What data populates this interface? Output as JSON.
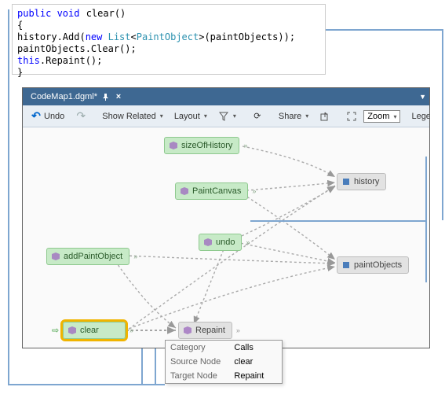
{
  "code": {
    "line1_pre": "public void ",
    "line1_method": "clear",
    "line1_post": "()",
    "line2": "{",
    "line3a": "    history.Add(",
    "line3b": "new ",
    "line3c": "List",
    "line3d": "<",
    "line3e": "PaintObject",
    "line3f": ">(paintObjects));",
    "line4": "    paintObjects.Clear();",
    "line5a": "    ",
    "line5b": "this",
    "line5c": ".Repaint();",
    "line6": "}"
  },
  "tab": {
    "title": "CodeMap1.dgml*"
  },
  "toolbar": {
    "undo": "Undo",
    "show_related": "Show Related",
    "layout": "Layout",
    "share": "Share",
    "zoom": "Zoom",
    "legend": "Legend"
  },
  "nodes": {
    "sizeOfHistory": "sizeOfHistory",
    "paintCanvas": "PaintCanvas",
    "addPaintObject": "addPaintObject",
    "undo": "undo",
    "clear": "clear",
    "history": "history",
    "paintObjects": "paintObjects",
    "repaint": "Repaint"
  },
  "tooltip": {
    "k1": "Category",
    "v1": "Calls",
    "k2": "Source Node",
    "v2": "clear",
    "k3": "Target Node",
    "v3": "Repaint"
  },
  "chart_data": {
    "type": "diagram",
    "title": "CodeMap1.dgml*",
    "nodes": [
      {
        "id": "sizeOfHistory",
        "kind": "method",
        "group": "green"
      },
      {
        "id": "PaintCanvas",
        "kind": "method",
        "group": "green"
      },
      {
        "id": "addPaintObject",
        "kind": "method",
        "group": "green"
      },
      {
        "id": "undo",
        "kind": "method",
        "group": "green"
      },
      {
        "id": "clear",
        "kind": "method",
        "group": "green",
        "selected": true
      },
      {
        "id": "history",
        "kind": "field",
        "group": "gray"
      },
      {
        "id": "paintObjects",
        "kind": "field",
        "group": "gray"
      },
      {
        "id": "Repaint",
        "kind": "method",
        "group": "gray"
      }
    ],
    "edges": [
      {
        "from": "sizeOfHistory",
        "to": "history",
        "category": "Calls"
      },
      {
        "from": "PaintCanvas",
        "to": "history",
        "category": "Calls"
      },
      {
        "from": "PaintCanvas",
        "to": "paintObjects",
        "category": "Calls"
      },
      {
        "from": "addPaintObject",
        "to": "paintObjects",
        "category": "Calls"
      },
      {
        "from": "addPaintObject",
        "to": "Repaint",
        "category": "Calls"
      },
      {
        "from": "undo",
        "to": "history",
        "category": "Calls"
      },
      {
        "from": "undo",
        "to": "paintObjects",
        "category": "Calls"
      },
      {
        "from": "undo",
        "to": "Repaint",
        "category": "Calls"
      },
      {
        "from": "clear",
        "to": "history",
        "category": "Calls"
      },
      {
        "from": "clear",
        "to": "paintObjects",
        "category": "Calls"
      },
      {
        "from": "clear",
        "to": "Repaint",
        "category": "Calls",
        "selected": true
      }
    ]
  }
}
